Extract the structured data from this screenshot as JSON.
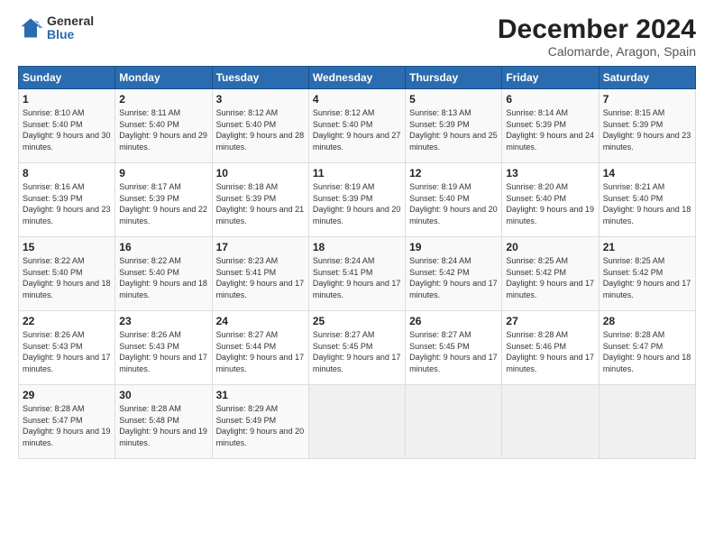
{
  "logo": {
    "general": "General",
    "blue": "Blue"
  },
  "title": "December 2024",
  "subtitle": "Calomarde, Aragon, Spain",
  "headers": [
    "Sunday",
    "Monday",
    "Tuesday",
    "Wednesday",
    "Thursday",
    "Friday",
    "Saturday"
  ],
  "weeks": [
    [
      {
        "day": "1",
        "sunrise": "8:10 AM",
        "sunset": "5:40 PM",
        "daylight": "9 hours and 30 minutes."
      },
      {
        "day": "2",
        "sunrise": "8:11 AM",
        "sunset": "5:40 PM",
        "daylight": "9 hours and 29 minutes."
      },
      {
        "day": "3",
        "sunrise": "8:12 AM",
        "sunset": "5:40 PM",
        "daylight": "9 hours and 28 minutes."
      },
      {
        "day": "4",
        "sunrise": "8:12 AM",
        "sunset": "5:40 PM",
        "daylight": "9 hours and 27 minutes."
      },
      {
        "day": "5",
        "sunrise": "8:13 AM",
        "sunset": "5:39 PM",
        "daylight": "9 hours and 25 minutes."
      },
      {
        "day": "6",
        "sunrise": "8:14 AM",
        "sunset": "5:39 PM",
        "daylight": "9 hours and 24 minutes."
      },
      {
        "day": "7",
        "sunrise": "8:15 AM",
        "sunset": "5:39 PM",
        "daylight": "9 hours and 23 minutes."
      }
    ],
    [
      {
        "day": "8",
        "sunrise": "8:16 AM",
        "sunset": "5:39 PM",
        "daylight": "9 hours and 23 minutes."
      },
      {
        "day": "9",
        "sunrise": "8:17 AM",
        "sunset": "5:39 PM",
        "daylight": "9 hours and 22 minutes."
      },
      {
        "day": "10",
        "sunrise": "8:18 AM",
        "sunset": "5:39 PM",
        "daylight": "9 hours and 21 minutes."
      },
      {
        "day": "11",
        "sunrise": "8:19 AM",
        "sunset": "5:39 PM",
        "daylight": "9 hours and 20 minutes."
      },
      {
        "day": "12",
        "sunrise": "8:19 AM",
        "sunset": "5:40 PM",
        "daylight": "9 hours and 20 minutes."
      },
      {
        "day": "13",
        "sunrise": "8:20 AM",
        "sunset": "5:40 PM",
        "daylight": "9 hours and 19 minutes."
      },
      {
        "day": "14",
        "sunrise": "8:21 AM",
        "sunset": "5:40 PM",
        "daylight": "9 hours and 18 minutes."
      }
    ],
    [
      {
        "day": "15",
        "sunrise": "8:22 AM",
        "sunset": "5:40 PM",
        "daylight": "9 hours and 18 minutes."
      },
      {
        "day": "16",
        "sunrise": "8:22 AM",
        "sunset": "5:40 PM",
        "daylight": "9 hours and 18 minutes."
      },
      {
        "day": "17",
        "sunrise": "8:23 AM",
        "sunset": "5:41 PM",
        "daylight": "9 hours and 17 minutes."
      },
      {
        "day": "18",
        "sunrise": "8:24 AM",
        "sunset": "5:41 PM",
        "daylight": "9 hours and 17 minutes."
      },
      {
        "day": "19",
        "sunrise": "8:24 AM",
        "sunset": "5:42 PM",
        "daylight": "9 hours and 17 minutes."
      },
      {
        "day": "20",
        "sunrise": "8:25 AM",
        "sunset": "5:42 PM",
        "daylight": "9 hours and 17 minutes."
      },
      {
        "day": "21",
        "sunrise": "8:25 AM",
        "sunset": "5:42 PM",
        "daylight": "9 hours and 17 minutes."
      }
    ],
    [
      {
        "day": "22",
        "sunrise": "8:26 AM",
        "sunset": "5:43 PM",
        "daylight": "9 hours and 17 minutes."
      },
      {
        "day": "23",
        "sunrise": "8:26 AM",
        "sunset": "5:43 PM",
        "daylight": "9 hours and 17 minutes."
      },
      {
        "day": "24",
        "sunrise": "8:27 AM",
        "sunset": "5:44 PM",
        "daylight": "9 hours and 17 minutes."
      },
      {
        "day": "25",
        "sunrise": "8:27 AM",
        "sunset": "5:45 PM",
        "daylight": "9 hours and 17 minutes."
      },
      {
        "day": "26",
        "sunrise": "8:27 AM",
        "sunset": "5:45 PM",
        "daylight": "9 hours and 17 minutes."
      },
      {
        "day": "27",
        "sunrise": "8:28 AM",
        "sunset": "5:46 PM",
        "daylight": "9 hours and 17 minutes."
      },
      {
        "day": "28",
        "sunrise": "8:28 AM",
        "sunset": "5:47 PM",
        "daylight": "9 hours and 18 minutes."
      }
    ],
    [
      {
        "day": "29",
        "sunrise": "8:28 AM",
        "sunset": "5:47 PM",
        "daylight": "9 hours and 19 minutes."
      },
      {
        "day": "30",
        "sunrise": "8:28 AM",
        "sunset": "5:48 PM",
        "daylight": "9 hours and 19 minutes."
      },
      {
        "day": "31",
        "sunrise": "8:29 AM",
        "sunset": "5:49 PM",
        "daylight": "9 hours and 20 minutes."
      },
      null,
      null,
      null,
      null
    ]
  ],
  "cell_labels": {
    "sunrise": "Sunrise:",
    "sunset": "Sunset:",
    "daylight": "Daylight:"
  }
}
